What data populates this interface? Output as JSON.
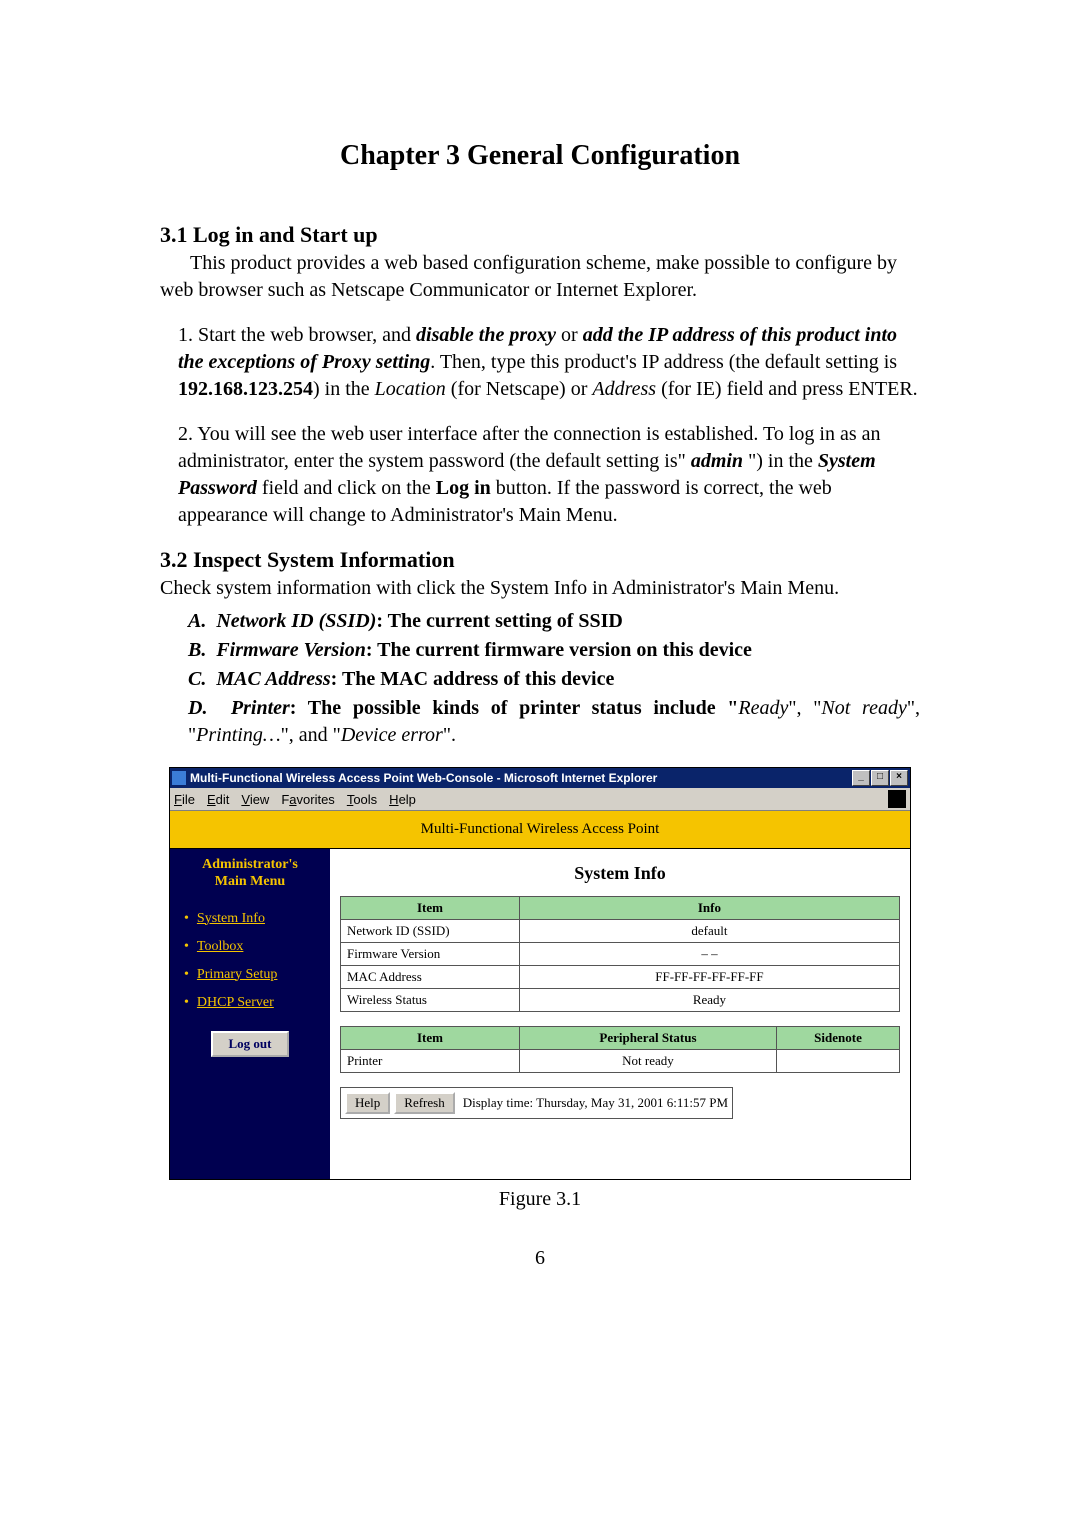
{
  "doc": {
    "chapter_title": "Chapter 3 General Configuration",
    "section_3_1_title": "3.1 Log in and Start up",
    "intro_para": "This product provides a web based configuration scheme, make possible to configure by web browser such as Netscape Communicator or Internet Explorer.",
    "step1_prefix": "1. Start the web browser, and ",
    "step1_bi_1": "disable the proxy",
    "step1_mid_1": " or ",
    "step1_bi_2": "add the IP address of this product into the exceptions of Proxy setting",
    "step1_mid_2": ". Then, type this product's IP address (the default setting is ",
    "step1_b_ip": "192.168.123.254",
    "step1_mid_3": ") in the ",
    "step1_i_loc": "Location",
    "step1_mid_4": " (for Netscape) or ",
    "step1_i_addr": "Address",
    "step1_end": " (for IE) field and press ENTER.",
    "step2_prefix": "2. You will see the web user interface after the connection is established. To log in as an administrator, enter the system password (the default setting is\" ",
    "step2_bi_admin": "admin",
    "step2_mid_1": " \") in the ",
    "step2_bi_sp": "System Password",
    "step2_mid_2": " field and click on the ",
    "step2_b_login": "Log in",
    "step2_end": " button. If the password is correct, the web appearance will change to Administrator's Main Menu.",
    "section_3_2_title": "3.2 Inspect System Information",
    "section_3_2_para": "Check system information with click the System Info in Administrator's Main Menu.",
    "itemA_label": "A.",
    "itemA_term": "Network ID (SSID)",
    "itemA_desc": ": The current setting of SSID",
    "itemB_label": "B.",
    "itemB_term": "Firmware Version",
    "itemB_desc": ": The current firmware version on this device",
    "itemC_label": "C.",
    "itemC_term": "MAC Address",
    "itemC_desc": ": The MAC address of this device",
    "itemD_label": "D.",
    "itemD_term": "Printer",
    "itemD_desc_1": ": The possible kinds of printer status include \"",
    "itemD_i_1": "Ready",
    "itemD_desc_2": "\", \"",
    "itemD_i_2": "Not ready",
    "itemD_desc_3": "\", \"",
    "itemD_i_3": "Printing…",
    "itemD_desc_4": "\", and \"",
    "itemD_i_4": "Device error",
    "itemD_desc_5": "\".",
    "figure_label": "Figure 3.1",
    "page_number": "6"
  },
  "window": {
    "title": "Multi-Functional Wireless Access Point Web-Console - Microsoft Internet Explorer",
    "controls": {
      "min": "_",
      "max": "□",
      "close": "×"
    },
    "menu": {
      "file": "File",
      "edit": "Edit",
      "view": "View",
      "favorites": "Favorites",
      "tools": "Tools",
      "help": "Help"
    },
    "banner": "Multi-Functional Wireless Access Point",
    "sidebar": {
      "header_line1": "Administrator's",
      "header_line2": "Main Menu",
      "items": [
        {
          "label": "System Info"
        },
        {
          "label": "Toolbox"
        },
        {
          "label": "Primary Setup"
        },
        {
          "label": "DHCP Server"
        }
      ],
      "logout_label": "Log out"
    },
    "panel": {
      "title": "System Info",
      "table1": {
        "headers": {
          "item": "Item",
          "info": "Info"
        },
        "rows": [
          {
            "item": "Network ID (SSID)",
            "info": "default"
          },
          {
            "item": "Firmware Version",
            "info": "– –"
          },
          {
            "item": "MAC Address",
            "info": "FF-FF-FF-FF-FF-FF"
          },
          {
            "item": "Wireless Status",
            "info": "Ready"
          }
        ]
      },
      "table2": {
        "headers": {
          "item": "Item",
          "status": "Peripheral Status",
          "sidenote": "Sidenote"
        },
        "rows": [
          {
            "item": "Printer",
            "status": "Not ready",
            "sidenote": ""
          }
        ]
      },
      "help_label": "Help",
      "refresh_label": "Refresh",
      "display_time": "Display time: Thursday, May 31, 2001 6:11:57 PM"
    }
  }
}
